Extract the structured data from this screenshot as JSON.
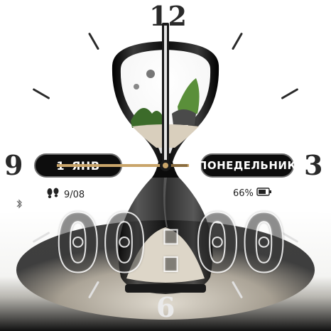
{
  "watch_face": {
    "hour_markers": {
      "twelve": "12",
      "three": "3",
      "six": "6",
      "nine": "9"
    },
    "date": {
      "day": "1",
      "month": "ЯНВ"
    },
    "weekday": "ПОНЕДЕЛЬНИК",
    "steps": {
      "value": "9/08",
      "icon": "footprints-icon"
    },
    "battery": {
      "value": "66%",
      "icon": "battery-icon"
    },
    "bluetooth_icon": "bluetooth-icon",
    "digital_time": "00:00",
    "colors": {
      "background_top": "#ffffff",
      "background_bottom": "#0a0a0a",
      "pill_background": "#0d0d0d",
      "pill_border": "#6e6e6e",
      "hand_accent": "#c9a56a",
      "glass_dark": "#111111"
    }
  }
}
